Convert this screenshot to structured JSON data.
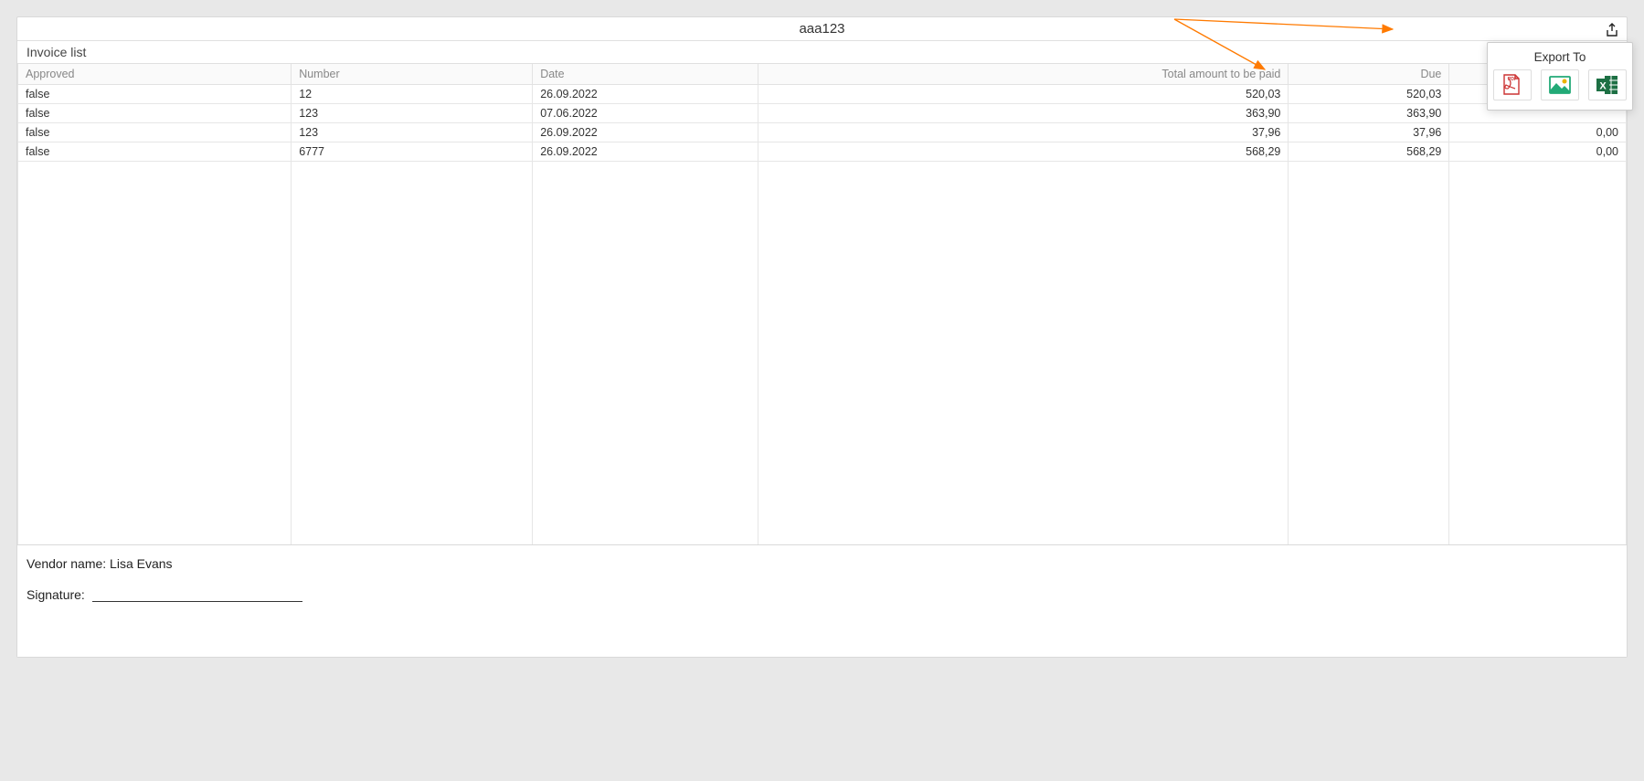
{
  "header": {
    "title": "aaa123",
    "section_title": "Invoice list"
  },
  "columns": {
    "approved": "Approved",
    "number": "Number",
    "date": "Date",
    "total_amount": "Total amount to be paid",
    "due": "Due",
    "last": ""
  },
  "rows": [
    {
      "approved": "false",
      "number": "12",
      "date": "26.09.2022",
      "total_amount": "520,03",
      "due": "520,03",
      "last": ""
    },
    {
      "approved": "false",
      "number": "123",
      "date": "07.06.2022",
      "total_amount": "363,90",
      "due": "363,90",
      "last": ""
    },
    {
      "approved": "false",
      "number": "123",
      "date": "26.09.2022",
      "total_amount": "37,96",
      "due": "37,96",
      "last": "0,00"
    },
    {
      "approved": "false",
      "number": "6777",
      "date": "26.09.2022",
      "total_amount": "568,29",
      "due": "568,29",
      "last": "0,00"
    }
  ],
  "footer": {
    "vendor_label": "Vendor name: Lisa Evans",
    "signature_label": "Signature:"
  },
  "export_popup": {
    "title": "Export To"
  }
}
